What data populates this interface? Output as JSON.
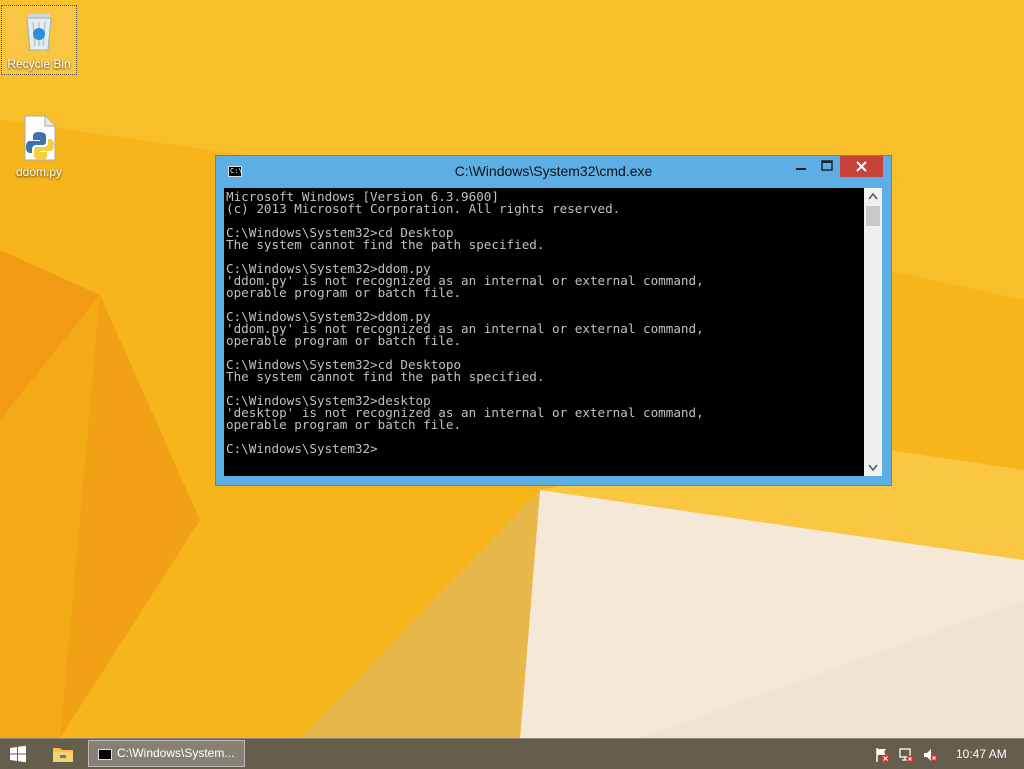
{
  "desktop": {
    "icons": [
      {
        "label": "Recycle Bin",
        "icon": "recycle-bin-icon"
      },
      {
        "label": "ddom.py",
        "icon": "python-file-icon"
      }
    ]
  },
  "cmd_window": {
    "title": "C:\\Windows\\System32\\cmd.exe",
    "console_lines": [
      "Microsoft Windows [Version 6.3.9600]",
      "(c) 2013 Microsoft Corporation. All rights reserved.",
      "",
      "C:\\Windows\\System32>cd Desktop",
      "The system cannot find the path specified.",
      "",
      "C:\\Windows\\System32>ddom.py",
      "'ddom.py' is not recognized as an internal or external command,",
      "operable program or batch file.",
      "",
      "C:\\Windows\\System32>ddom.py",
      "'ddom.py' is not recognized as an internal or external command,",
      "operable program or batch file.",
      "",
      "C:\\Windows\\System32>cd Desktopo",
      "The system cannot find the path specified.",
      "",
      "C:\\Windows\\System32>desktop",
      "'desktop' is not recognized as an internal or external command,",
      "operable program or batch file.",
      "",
      "C:\\Windows\\System32>"
    ]
  },
  "taskbar": {
    "cmd_task_label": "C:\\Windows\\System...",
    "clock": "10:47 AM"
  },
  "colors": {
    "accent": "#5eaee6",
    "close_button": "#c7403a",
    "console_bg": "#000000",
    "console_text": "#c0c0c0"
  }
}
